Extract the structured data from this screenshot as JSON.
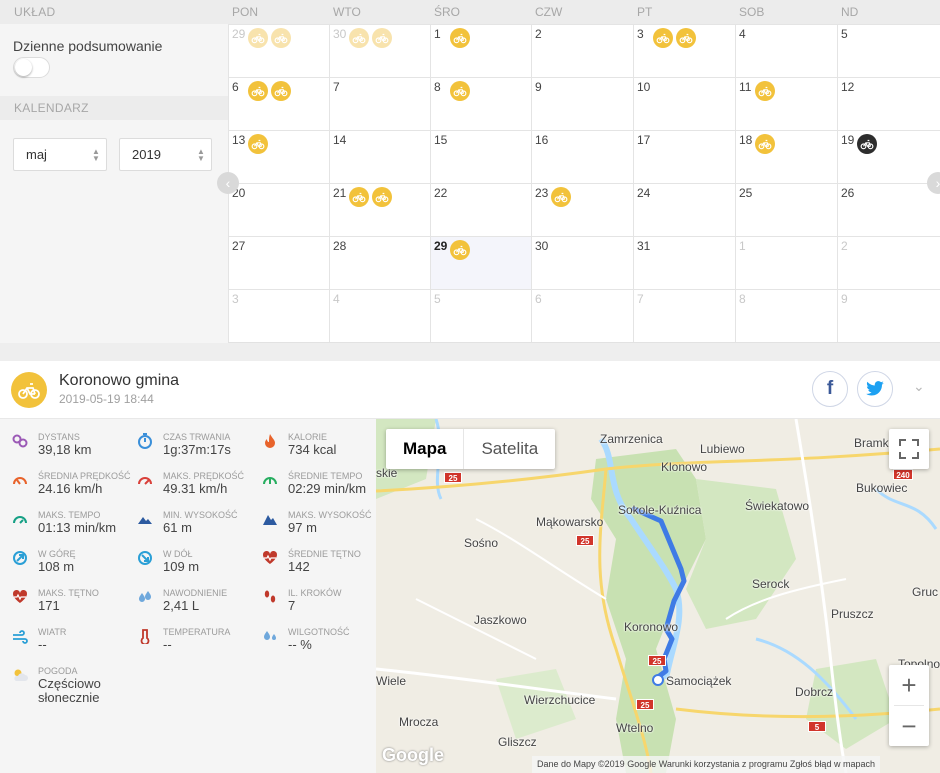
{
  "left": {
    "layout_heading": "UKŁAD",
    "summary_label": "Dzienne podsumowanie",
    "calendar_heading": "KALENDARZ",
    "month": "maj",
    "year": "2019"
  },
  "calendar": {
    "day_names": [
      "PON",
      "WTO",
      "ŚRO",
      "CZW",
      "PT",
      "SOB",
      "ND"
    ],
    "weeks": [
      [
        {
          "d": "29",
          "other": true,
          "rides": 2,
          "faded": true
        },
        {
          "d": "30",
          "other": true,
          "rides": 2,
          "faded": true
        },
        {
          "d": "1",
          "rides": 1
        },
        {
          "d": "2"
        },
        {
          "d": "3",
          "rides": 2
        },
        {
          "d": "4"
        },
        {
          "d": "5"
        }
      ],
      [
        {
          "d": "6",
          "rides": 2
        },
        {
          "d": "7"
        },
        {
          "d": "8",
          "rides": 1
        },
        {
          "d": "9"
        },
        {
          "d": "10"
        },
        {
          "d": "11",
          "rides": 1
        },
        {
          "d": "12"
        }
      ],
      [
        {
          "d": "13",
          "rides": 1
        },
        {
          "d": "14"
        },
        {
          "d": "15"
        },
        {
          "d": "16"
        },
        {
          "d": "17"
        },
        {
          "d": "18",
          "rides": 1
        },
        {
          "d": "19",
          "rides": 1,
          "dark": true
        }
      ],
      [
        {
          "d": "20"
        },
        {
          "d": "21",
          "rides": 2
        },
        {
          "d": "22"
        },
        {
          "d": "23",
          "rides": 1
        },
        {
          "d": "24"
        },
        {
          "d": "25"
        },
        {
          "d": "26"
        }
      ],
      [
        {
          "d": "27"
        },
        {
          "d": "28"
        },
        {
          "d": "29",
          "rides": 1,
          "today": true
        },
        {
          "d": "30"
        },
        {
          "d": "31"
        },
        {
          "d": "1",
          "other": true
        },
        {
          "d": "2",
          "other": true
        }
      ],
      [
        {
          "d": "3",
          "other": true
        },
        {
          "d": "4",
          "other": true
        },
        {
          "d": "5",
          "other": true
        },
        {
          "d": "6",
          "other": true
        },
        {
          "d": "7",
          "other": true
        },
        {
          "d": "8",
          "other": true
        },
        {
          "d": "9",
          "other": true
        }
      ]
    ]
  },
  "activity": {
    "title": "Koronowo gmina",
    "datetime": "2019-05-19 18:44",
    "share_facebook": "f"
  },
  "stats": [
    {
      "icon": "distance-icon",
      "label": "DYSTANS",
      "value": "39,18 km",
      "color": "#9b59b6"
    },
    {
      "icon": "duration-icon",
      "label": "CZAS TRWANIA",
      "value": "1g:37m:17s",
      "color": "#3a8fd9"
    },
    {
      "icon": "calories-icon",
      "label": "KALORIE",
      "value": "734 kcal",
      "color": "#e8632b"
    },
    {
      "icon": "avg-speed-icon",
      "label": "ŚREDNIA PRĘDKOŚĆ",
      "value": "24.16 km/h",
      "color": "#e8632b"
    },
    {
      "icon": "max-speed-icon",
      "label": "MAKS. PRĘDKOŚĆ",
      "value": "49.31 km/h",
      "color": "#d9403a"
    },
    {
      "icon": "avg-pace-icon",
      "label": "ŚREDNIE TEMPO",
      "value": "02:29 min/km",
      "color": "#27ae60"
    },
    {
      "icon": "max-pace-icon",
      "label": "MAKS. TEMPO",
      "value": "01:13 min/km",
      "color": "#16a085"
    },
    {
      "icon": "min-altitude-icon",
      "label": "MIN. WYSOKOŚĆ",
      "value": "61 m",
      "color": "#2c5aa0"
    },
    {
      "icon": "max-altitude-icon",
      "label": "MAKS. WYSOKOŚĆ",
      "value": "97 m",
      "color": "#2c5aa0"
    },
    {
      "icon": "ascent-icon",
      "label": "W GÓRĘ",
      "value": "108 m",
      "color": "#2a9fd6"
    },
    {
      "icon": "descent-icon",
      "label": "W DÓŁ",
      "value": "109 m",
      "color": "#2a9fd6"
    },
    {
      "icon": "avg-heart-rate-icon",
      "label": "ŚREDNIE TĘTNO",
      "value": "142",
      "color": "#c0392b"
    },
    {
      "icon": "max-heart-rate-icon",
      "label": "MAKS. TĘTNO",
      "value": "171",
      "color": "#c0392b"
    },
    {
      "icon": "hydration-icon",
      "label": "NAWODNIENIE",
      "value": "2,41 L",
      "color": "#6fa8dc"
    },
    {
      "icon": "steps-icon",
      "label": "IL. KROKÓW",
      "value": "7",
      "color": "#c0392b"
    },
    {
      "icon": "wind-icon",
      "label": "WIATR",
      "value": "--",
      "color": "#2a9fd6"
    },
    {
      "icon": "temperature-icon",
      "label": "TEMPERATURA",
      "value": "--",
      "color": "#c0392b"
    },
    {
      "icon": "humidity-icon",
      "label": "WILGOTNOŚĆ",
      "value": "-- %",
      "color": "#6fa8dc"
    },
    {
      "icon": "weather-icon",
      "label": "POGODA",
      "value": "Częściowo słonecznie",
      "color": "#f2c23b"
    }
  ],
  "map": {
    "type_map": "Mapa",
    "type_satellite": "Satelita",
    "attribution": "Dane do Mapy ©2019 Google   Warunki korzystania z programu   Zgłoś błąd w mapach",
    "google": "Google",
    "zoom_in": "+",
    "zoom_out": "−",
    "places": [
      {
        "name": "Zamrzenica"
      },
      {
        "name": "Lubiewo"
      },
      {
        "name": "Bramk"
      },
      {
        "name": "Klonowo"
      },
      {
        "name": "Bukowiec"
      },
      {
        "name": "Świekatowo"
      },
      {
        "name": "Sokole-Kuźnica"
      },
      {
        "name": "Mąkowarsko"
      },
      {
        "name": "Sośno"
      },
      {
        "name": "Serock"
      },
      {
        "name": "Pruszcz"
      },
      {
        "name": "Jaszkowo"
      },
      {
        "name": "Koronowo"
      },
      {
        "name": "Samociążek"
      },
      {
        "name": "Wiele"
      },
      {
        "name": "Dobrcz"
      },
      {
        "name": "Topolno"
      },
      {
        "name": "Wierzchucice"
      },
      {
        "name": "Mrocza"
      },
      {
        "name": "Wtelno"
      },
      {
        "name": "Gliszcz"
      },
      {
        "name": "Gruc"
      },
      {
        "name": "skie"
      }
    ],
    "road_numbers": [
      "25",
      "25",
      "25",
      "25",
      "240",
      "5"
    ]
  },
  "colors": {
    "ride": "#f2c23b",
    "route": "#3f7be5",
    "water": "#aadaff",
    "forest": "#c8e1b2"
  }
}
